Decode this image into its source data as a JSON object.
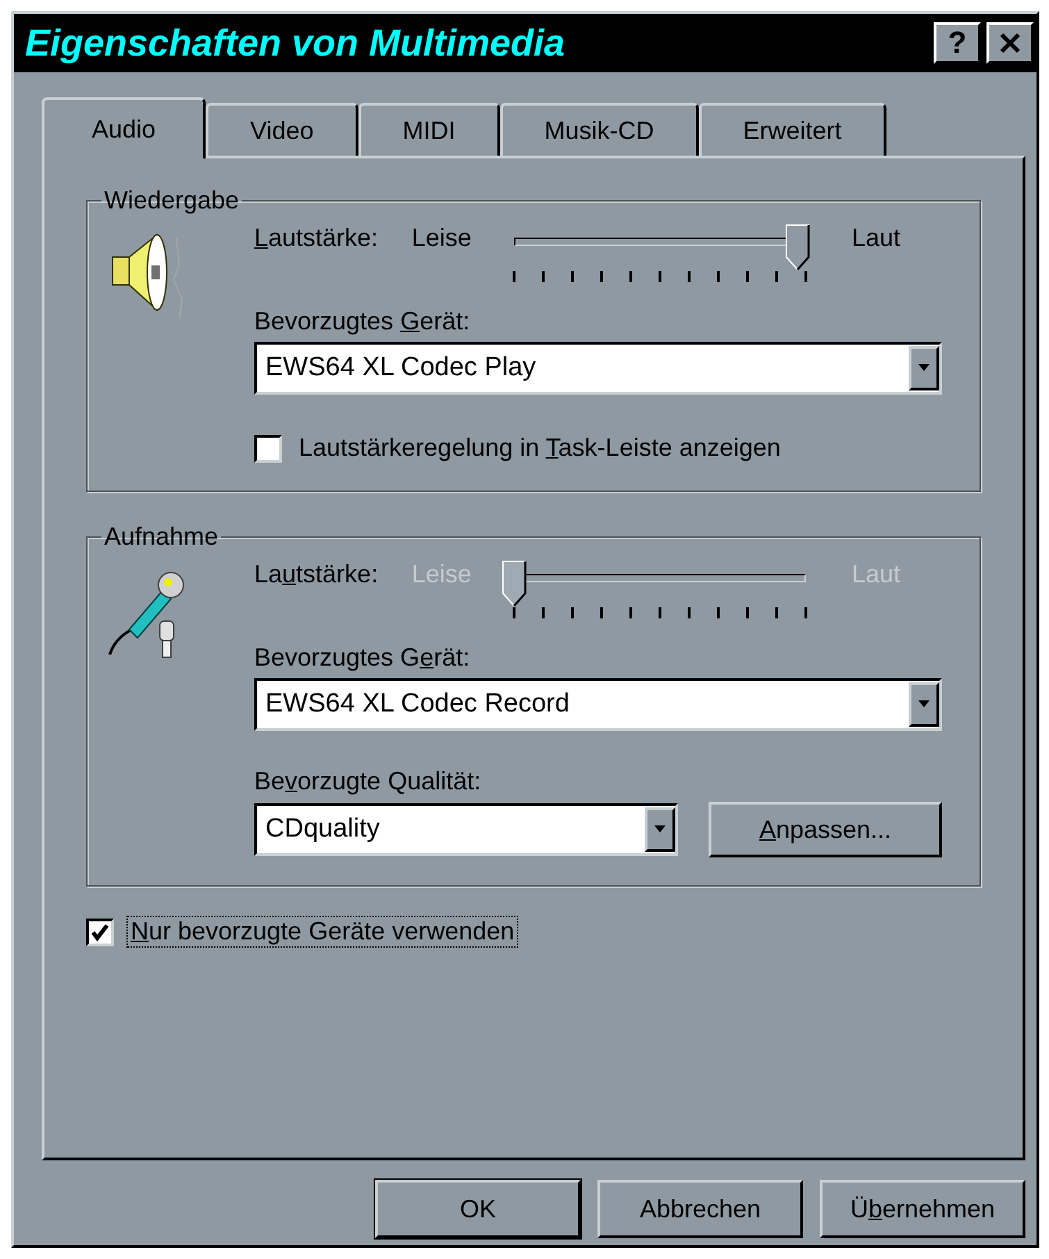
{
  "window": {
    "title": "Eigenschaften von Multimedia",
    "help_button": "?"
  },
  "tabs": [
    {
      "label": "Audio",
      "selected": true
    },
    {
      "label": "Video",
      "selected": false
    },
    {
      "label": "MIDI",
      "selected": false
    },
    {
      "label": "Musik-CD",
      "selected": false
    },
    {
      "label": "Erweitert",
      "selected": false
    }
  ],
  "sections": [
    {
      "title": "Wiedergabe",
      "kind": "speaker",
      "volume": {
        "label": [
          {
            "text": "L",
            "underline": true
          },
          {
            "text": "autstärke:",
            "underline": false
          }
        ],
        "min": "Leise",
        "max": "Laut",
        "level": 0.97,
        "disabled": false
      },
      "device": {
        "label": [
          {
            "text": "Bevorzugtes ",
            "underline": false
          },
          {
            "text": "G",
            "underline": true
          },
          {
            "text": "erät:",
            "underline": false
          }
        ],
        "value": "EWS64 XL Codec Play"
      },
      "checkbox": {
        "label": [
          {
            "text": "Lautstärkeregelung in ",
            "underline": false
          },
          {
            "text": "T",
            "underline": true
          },
          {
            "text": "ask-Leiste anzeigen",
            "underline": false
          }
        ],
        "checked": false
      }
    },
    {
      "title": "Aufnahme",
      "kind": "microphone",
      "volume": {
        "label": [
          {
            "text": "La",
            "underline": false
          },
          {
            "text": "u",
            "underline": true
          },
          {
            "text": "tstärke:",
            "underline": false
          }
        ],
        "min": "Leise",
        "max": "Laut",
        "level": 0.0,
        "disabled": true
      },
      "device": {
        "label": [
          {
            "text": "Bevorzugtes G",
            "underline": false
          },
          {
            "text": "e",
            "underline": true
          },
          {
            "text": "rät:",
            "underline": false
          }
        ],
        "value": "EWS64 XL Codec Record"
      },
      "quality": {
        "label": [
          {
            "text": "Be",
            "underline": false
          },
          {
            "text": "v",
            "underline": true
          },
          {
            "text": "orzugte Qualität:",
            "underline": false
          }
        ],
        "value": "CDquality",
        "button": [
          {
            "text": "A",
            "underline": true
          },
          {
            "text": "npassen...",
            "underline": false
          }
        ]
      }
    }
  ],
  "preferred_only": {
    "label": [
      {
        "text": "N",
        "underline": true
      },
      {
        "text": "ur bevorzugte Geräte verwenden",
        "underline": false
      }
    ],
    "checked": true,
    "focused": true
  },
  "buttons": [
    {
      "label": [
        {
          "text": "OK",
          "underline": false
        }
      ],
      "default": true
    },
    {
      "label": [
        {
          "text": "Abbrechen",
          "underline": false
        }
      ],
      "default": false
    },
    {
      "label": [
        {
          "text": "Ü",
          "underline": false
        },
        {
          "text": "b",
          "underline": true
        },
        {
          "text": "ernehmen",
          "underline": false
        }
      ],
      "default": false
    }
  ]
}
